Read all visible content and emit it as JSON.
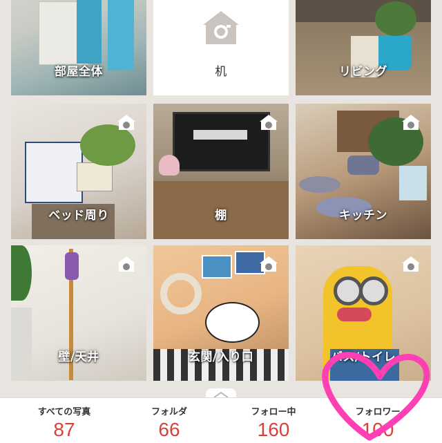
{
  "folders": [
    {
      "label": "部屋全体",
      "photo": true,
      "camera": false
    },
    {
      "label": "机",
      "photo": false,
      "camera": false
    },
    {
      "label": "リビング",
      "photo": true,
      "camera": false
    },
    {
      "label": "ベッド周り",
      "photo": true,
      "camera": true
    },
    {
      "label": "棚",
      "photo": true,
      "camera": true
    },
    {
      "label": "キッチン",
      "photo": true,
      "camera": true
    },
    {
      "label": "壁/天井",
      "photo": true,
      "camera": true
    },
    {
      "label": "玄関/入り口",
      "photo": true,
      "camera": true
    },
    {
      "label": "バス/トイレ",
      "photo": true,
      "camera": true
    }
  ],
  "stats": {
    "all_photos_label": "すべての写真",
    "all_photos_count": "87",
    "folders_label": "フォルダ",
    "folders_count": "66",
    "following_label": "フォロー中",
    "following_count": "160",
    "followers_label": "フォロワー",
    "followers_count": "100"
  },
  "colors": {
    "accent": "#d9403a",
    "heart": "#ff3fb4"
  }
}
